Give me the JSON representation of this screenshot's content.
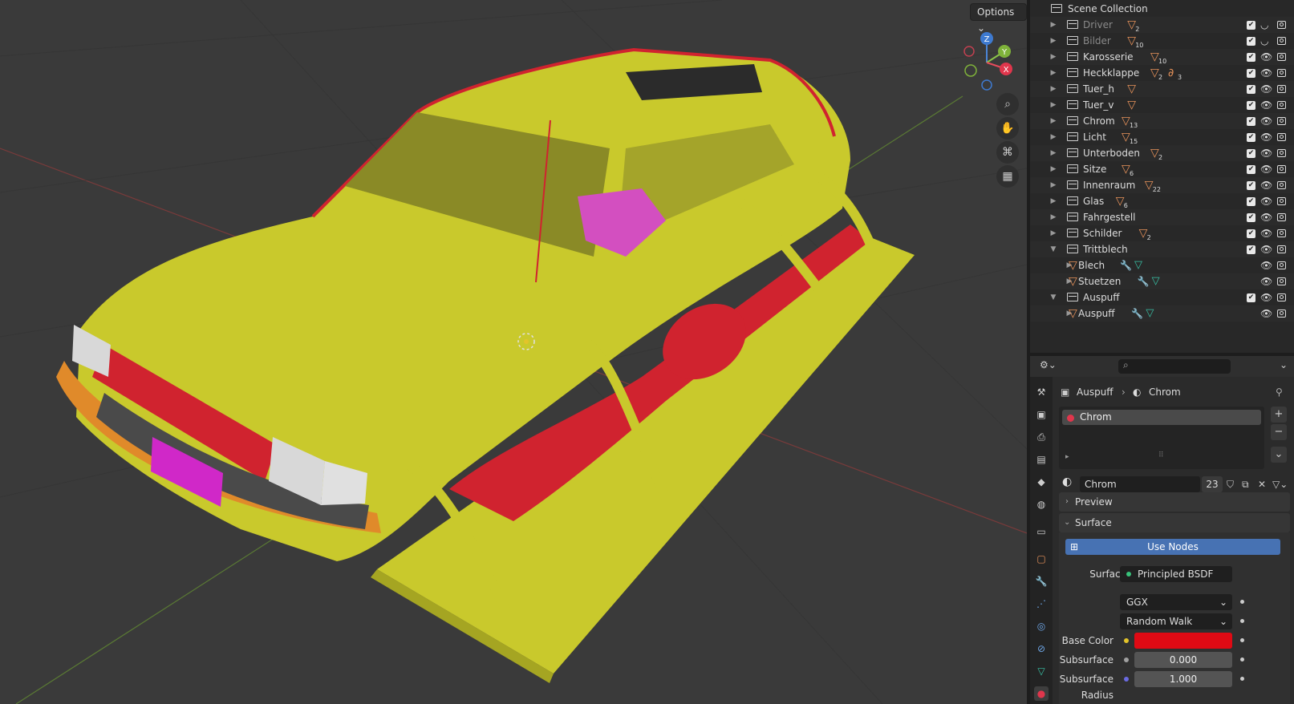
{
  "viewport": {
    "options_label": "Options",
    "gizmo": {
      "z": "Z",
      "y": "Y",
      "x": "X"
    }
  },
  "outliner": {
    "title": "Scene Collection",
    "rows": [
      {
        "name": "Driver",
        "count": "2",
        "dim": true
      },
      {
        "name": "Bilder",
        "count": "10",
        "dim": true
      },
      {
        "name": "Karosserie",
        "count": "10"
      },
      {
        "name": "Heckklappe",
        "count": "2",
        "count2": "3"
      },
      {
        "name": "Tuer_h",
        "count": ""
      },
      {
        "name": "Tuer_v",
        "count": ""
      },
      {
        "name": "Chrom",
        "count": "13"
      },
      {
        "name": "Licht",
        "count": "15"
      },
      {
        "name": "Unterboden",
        "count": "2"
      },
      {
        "name": "Sitze",
        "count": "6"
      },
      {
        "name": "Innenraum",
        "count": "22"
      },
      {
        "name": "Glas",
        "count": "6"
      },
      {
        "name": "Fahrgestell",
        "count": ""
      },
      {
        "name": "Schilder",
        "count": "2"
      },
      {
        "name": "Trittblech",
        "count": ""
      },
      {
        "name": "Blech",
        "count": ""
      },
      {
        "name": "Stuetzen",
        "count": ""
      },
      {
        "name": "Auspuff",
        "count": ""
      },
      {
        "name": "Auspuff",
        "count": ""
      }
    ]
  },
  "properties": {
    "breadcrumb_object": "Auspuff",
    "breadcrumb_material": "Chrom",
    "slot_name": "Chrom",
    "material_name": "Chrom",
    "users": "23",
    "preview_label": "Preview",
    "surface_panel_label": "Surface",
    "use_nodes_label": "Use Nodes",
    "surface_label": "Surface",
    "surface_value": "Principled BSDF",
    "distribution": "GGX",
    "subsurface_method": "Random Walk",
    "base_color_label": "Base Color",
    "base_color": "#e00a14",
    "subsurface_label": "Subsurface",
    "subsurface_value": "0.000",
    "subsurface_radius_label": "Subsurface Radius",
    "subsurface_radius_value": "1.000"
  },
  "colors": {
    "body": "#c9c92c",
    "red": "#d0232f",
    "accent": "#4772b3"
  }
}
